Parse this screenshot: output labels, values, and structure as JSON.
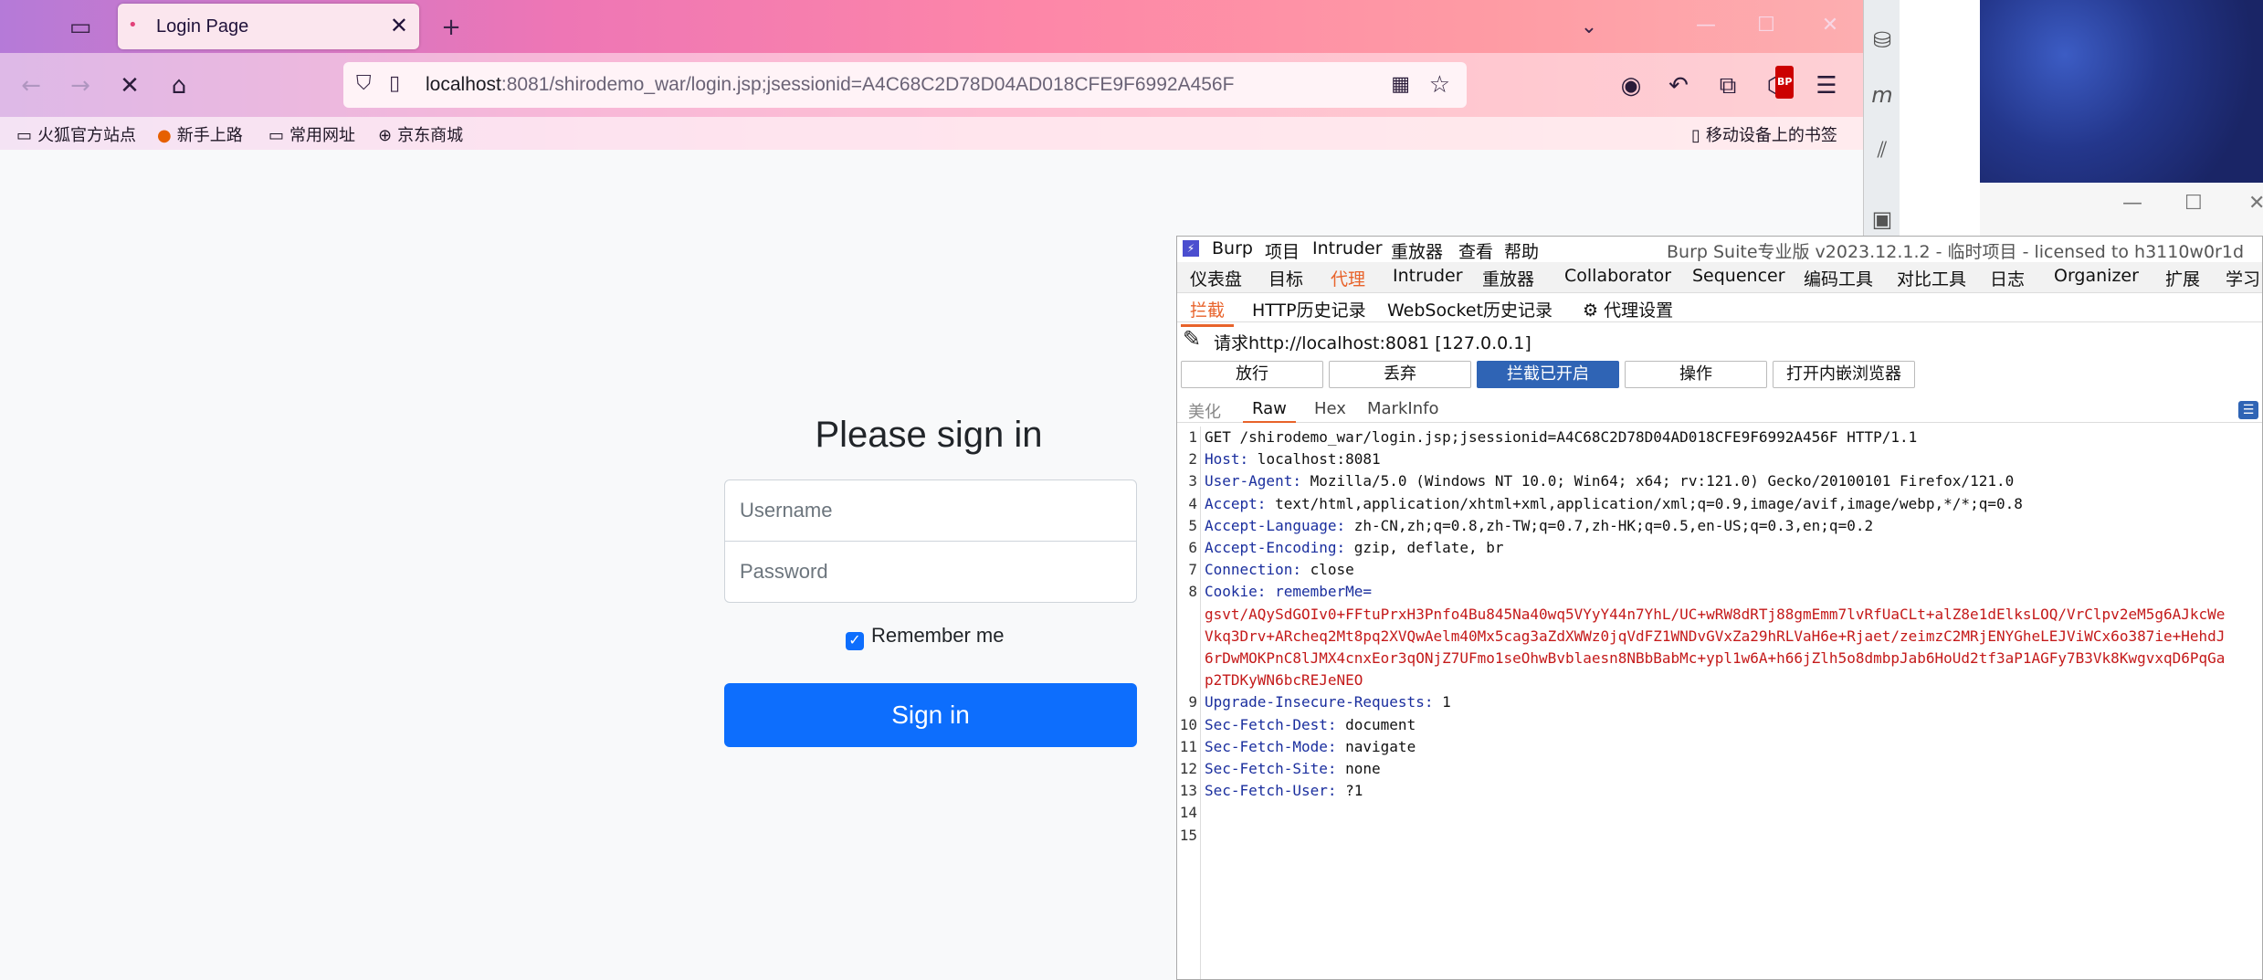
{
  "browser": {
    "tab_title": "Login Page",
    "url_host": "localhost",
    "url_rest": ":8081/shirodemo_war/login.jsp;jsessionid=A4C68C2D78D04AD018CFE9F6992A456F",
    "extension_badge": "BP",
    "bookmarks": [
      "火狐官方站点",
      "新手上路",
      "常用网址",
      "京东商城"
    ],
    "mobile_bookmarks": "移动设备上的书签"
  },
  "login": {
    "heading": "Please sign in",
    "username_placeholder": "Username",
    "password_placeholder": "Password",
    "remember_label": "Remember me",
    "remember_checked": true,
    "submit_label": "Sign in"
  },
  "burp": {
    "menu": [
      "Burp",
      "项目",
      "Intruder",
      "重放器",
      "查看",
      "帮助"
    ],
    "window_title": "Burp Suite专业版  v2023.12.1.2 - 临时项目 - licensed to h3110w0r1d",
    "tabs": [
      "仪表盘",
      "目标",
      "代理",
      "Intruder",
      "重放器",
      "Collaborator",
      "Sequencer",
      "编码工具",
      "对比工具",
      "日志",
      "Organizer",
      "扩展",
      "学习"
    ],
    "active_tab": "代理",
    "subtabs": [
      "拦截",
      "HTTP历史记录",
      "WebSocket历史记录",
      "代理设置"
    ],
    "active_subtab": "拦截",
    "request_target": "请求http://localhost:8081  [127.0.0.1]",
    "buttons": {
      "forward": "放行",
      "drop": "丢弃",
      "intercept": "拦截已开启",
      "action": "操作",
      "browser": "打开内嵌浏览器"
    },
    "view_tabs": [
      "美化",
      "Raw",
      "Hex",
      "MarkInfo"
    ],
    "active_view": "Raw",
    "request_lines": [
      {
        "num": "1",
        "key": "",
        "value": "GET /shirodemo_war/login.jsp;jsessionid=A4C68C2D78D04AD018CFE9F6992A456F HTTP/1.1"
      },
      {
        "num": "2",
        "key": "Host",
        "value": " localhost:8081"
      },
      {
        "num": "3",
        "key": "User-Agent",
        "value": " Mozilla/5.0 (Windows NT 10.0; Win64; x64; rv:121.0) Gecko/20100101 Firefox/121.0"
      },
      {
        "num": "4",
        "key": "Accept",
        "value": " text/html,application/xhtml+xml,application/xml;q=0.9,image/avif,image/webp,*/*;q=0.8"
      },
      {
        "num": "5",
        "key": "Accept-Language",
        "value": " zh-CN,zh;q=0.8,zh-TW;q=0.7,zh-HK;q=0.5,en-US;q=0.3,en;q=0.2"
      },
      {
        "num": "6",
        "key": "Accept-Encoding",
        "value": " gzip, deflate, br"
      },
      {
        "num": "7",
        "key": "Connection",
        "value": " close"
      },
      {
        "num": "8",
        "key": "Cookie",
        "value": " rememberMe="
      }
    ],
    "cookie_value_lines": [
      "gsvt/AQySdGOIv0+FFtuPrxH3Pnfo4Bu845Na40wq5VYyY44n7YhL/UC+wRW8dRTj88gmEmm7lvRfUaCLt+alZ8e1dElksLOQ/VrClpv2eM5g6AJkcWe",
      "Vkq3Drv+ARcheq2Mt8pq2XVQwAelm40Mx5cag3aZdXWWz0jqVdFZ1WNDvGVxZa29hRLVaH6e+Rjaet/zeimzC2MRjENYGheLEJViWCx6o387ie+HehdJ",
      "6rDwMOKPnC8lJMX4cnxEor3qONjZ7UFmo1seOhwBvblaesn8NBbBabMc+ypl1w6A+h66jZlh5o8dmbpJab6HoUd2tf3aP1AGFy7B3Vk8KwgvxqD6PqGa",
      "p2TDKyWN6bcREJeNEO"
    ],
    "request_lines_after": [
      {
        "num": "9",
        "key": "Upgrade-Insecure-Requests",
        "value": " 1"
      },
      {
        "num": "10",
        "key": "Sec-Fetch-Dest",
        "value": " document"
      },
      {
        "num": "11",
        "key": "Sec-Fetch-Mode",
        "value": " navigate"
      },
      {
        "num": "12",
        "key": "Sec-Fetch-Site",
        "value": " none"
      },
      {
        "num": "13",
        "key": "Sec-Fetch-User",
        "value": " ?1"
      },
      {
        "num": "14",
        "key": "",
        "value": ""
      },
      {
        "num": "15",
        "key": "",
        "value": ""
      }
    ]
  }
}
